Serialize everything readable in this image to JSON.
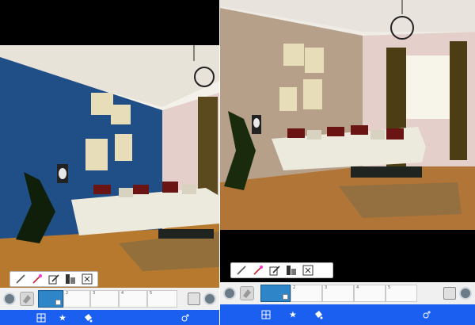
{
  "colors": {
    "accent_blue": "#1a5ff0",
    "active_swatch": "#2e86c8",
    "wall_blue": "#1f4f86",
    "wall_beige": "#b6a08a",
    "wall_pink": "#e4cfca",
    "floor": "#b7792e",
    "strip_bg": "#f0f0f0"
  },
  "toolbar": {
    "tools": [
      {
        "icon": "pencil-icon"
      },
      {
        "icon": "magic-wand-icon"
      },
      {
        "icon": "edit-icon"
      },
      {
        "icon": "layers-icon"
      },
      {
        "icon": "close-icon"
      }
    ]
  },
  "swatches": {
    "left": [
      {
        "num": "",
        "active": true
      },
      {
        "num": "2",
        "active": false
      },
      {
        "num": "3",
        "active": false
      },
      {
        "num": "4",
        "active": false
      },
      {
        "num": "5",
        "active": false
      }
    ],
    "right": [
      {
        "num": "",
        "active": true
      },
      {
        "num": "2",
        "active": false
      },
      {
        "num": "3",
        "active": false
      },
      {
        "num": "4",
        "active": false
      },
      {
        "num": "5",
        "active": false
      }
    ]
  },
  "bottom_nav": {
    "items": [
      {
        "icon": "grid-icon"
      },
      {
        "icon": "star-icon"
      },
      {
        "icon": "paint-bucket-icon"
      },
      {
        "icon": "add-color-icon"
      }
    ]
  }
}
